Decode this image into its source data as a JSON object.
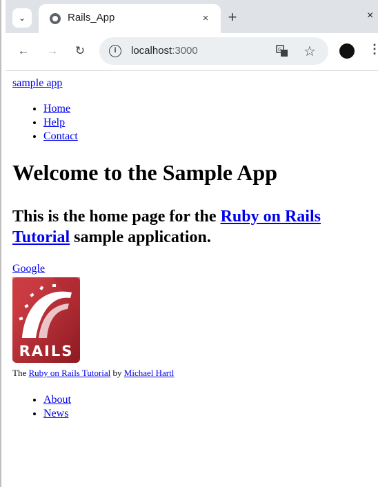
{
  "browser": {
    "tab": {
      "title": "Rails_App",
      "close": "×"
    },
    "new_tab": "+",
    "window_close": "×",
    "url_host": "localhost",
    "url_port": ":3000"
  },
  "page": {
    "brand": "sample app",
    "nav": [
      "Home",
      "Help",
      "Contact"
    ],
    "heading": "Welcome to the Sample App",
    "tagline": {
      "before": "This is the home page for the ",
      "link": "Ruby on Rails Tutorial",
      "after": " sample application."
    },
    "google_link": "Google",
    "logo_text": "RAILS",
    "footer": {
      "prefix": "The ",
      "tutorial_link": "Ruby on Rails Tutorial",
      "middle": " by ",
      "author_link": "Michael Hartl"
    },
    "footer_nav": [
      "About",
      "News"
    ]
  }
}
